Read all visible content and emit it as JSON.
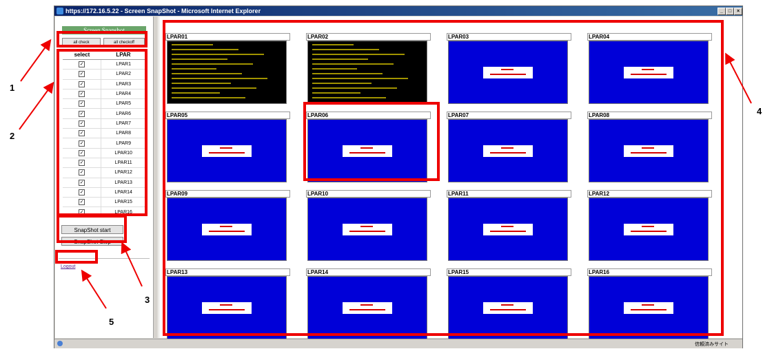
{
  "window": {
    "title": "https://172.16.5.22 - Screen SnapShot - Microsoft Internet Explorer",
    "buttons": [
      "_",
      "□",
      "×"
    ]
  },
  "sidebar": {
    "header": "Screen Snapshot",
    "check_all": "all check",
    "check_off": "all checkoff",
    "col_select": "select",
    "col_lpar": "LPAR",
    "rows": [
      {
        "lpar": "LPAR1",
        "checked": true
      },
      {
        "lpar": "LPAR2",
        "checked": true
      },
      {
        "lpar": "LPAR3",
        "checked": true
      },
      {
        "lpar": "LPAR4",
        "checked": true
      },
      {
        "lpar": "LPAR5",
        "checked": true
      },
      {
        "lpar": "LPAR6",
        "checked": true
      },
      {
        "lpar": "LPAR7",
        "checked": true
      },
      {
        "lpar": "LPAR8",
        "checked": true
      },
      {
        "lpar": "LPAR9",
        "checked": true
      },
      {
        "lpar": "LPAR10",
        "checked": true
      },
      {
        "lpar": "LPAR11",
        "checked": true
      },
      {
        "lpar": "LPAR12",
        "checked": true
      },
      {
        "lpar": "LPAR13",
        "checked": true
      },
      {
        "lpar": "LPAR14",
        "checked": true
      },
      {
        "lpar": "LPAR15",
        "checked": true
      },
      {
        "lpar": "LPAR16",
        "checked": true
      }
    ],
    "snapshot_start": "SnapShot start",
    "snapshot_stop": "SnapShot Stop",
    "logout": "Logout"
  },
  "panes": [
    {
      "label": "LPAR01",
      "screen": "console"
    },
    {
      "label": "LPAR02",
      "screen": "console"
    },
    {
      "label": "LPAR03",
      "screen": "blue"
    },
    {
      "label": "LPAR04",
      "screen": "blue"
    },
    {
      "label": "LPAR05",
      "screen": "blue"
    },
    {
      "label": "LPAR06",
      "screen": "blue"
    },
    {
      "label": "LPAR07",
      "screen": "blue"
    },
    {
      "label": "LPAR08",
      "screen": "blue"
    },
    {
      "label": "LPAR09",
      "screen": "blue"
    },
    {
      "label": "LPAR10",
      "screen": "blue"
    },
    {
      "label": "LPAR11",
      "screen": "blue"
    },
    {
      "label": "LPAR12",
      "screen": "blue"
    },
    {
      "label": "LPAR13",
      "screen": "blue"
    },
    {
      "label": "LPAR14",
      "screen": "blue"
    },
    {
      "label": "LPAR15",
      "screen": "blue"
    },
    {
      "label": "LPAR16",
      "screen": "blue"
    }
  ],
  "statusbar": {
    "zone": "信頼済みサイト"
  },
  "callouts": [
    "1",
    "2",
    "3",
    "4",
    "5"
  ],
  "colors": {
    "highlight": "#ee0000",
    "screen_blue": "#0000d8",
    "console_text": "#ffd500",
    "title_bar": "#0a246a"
  }
}
